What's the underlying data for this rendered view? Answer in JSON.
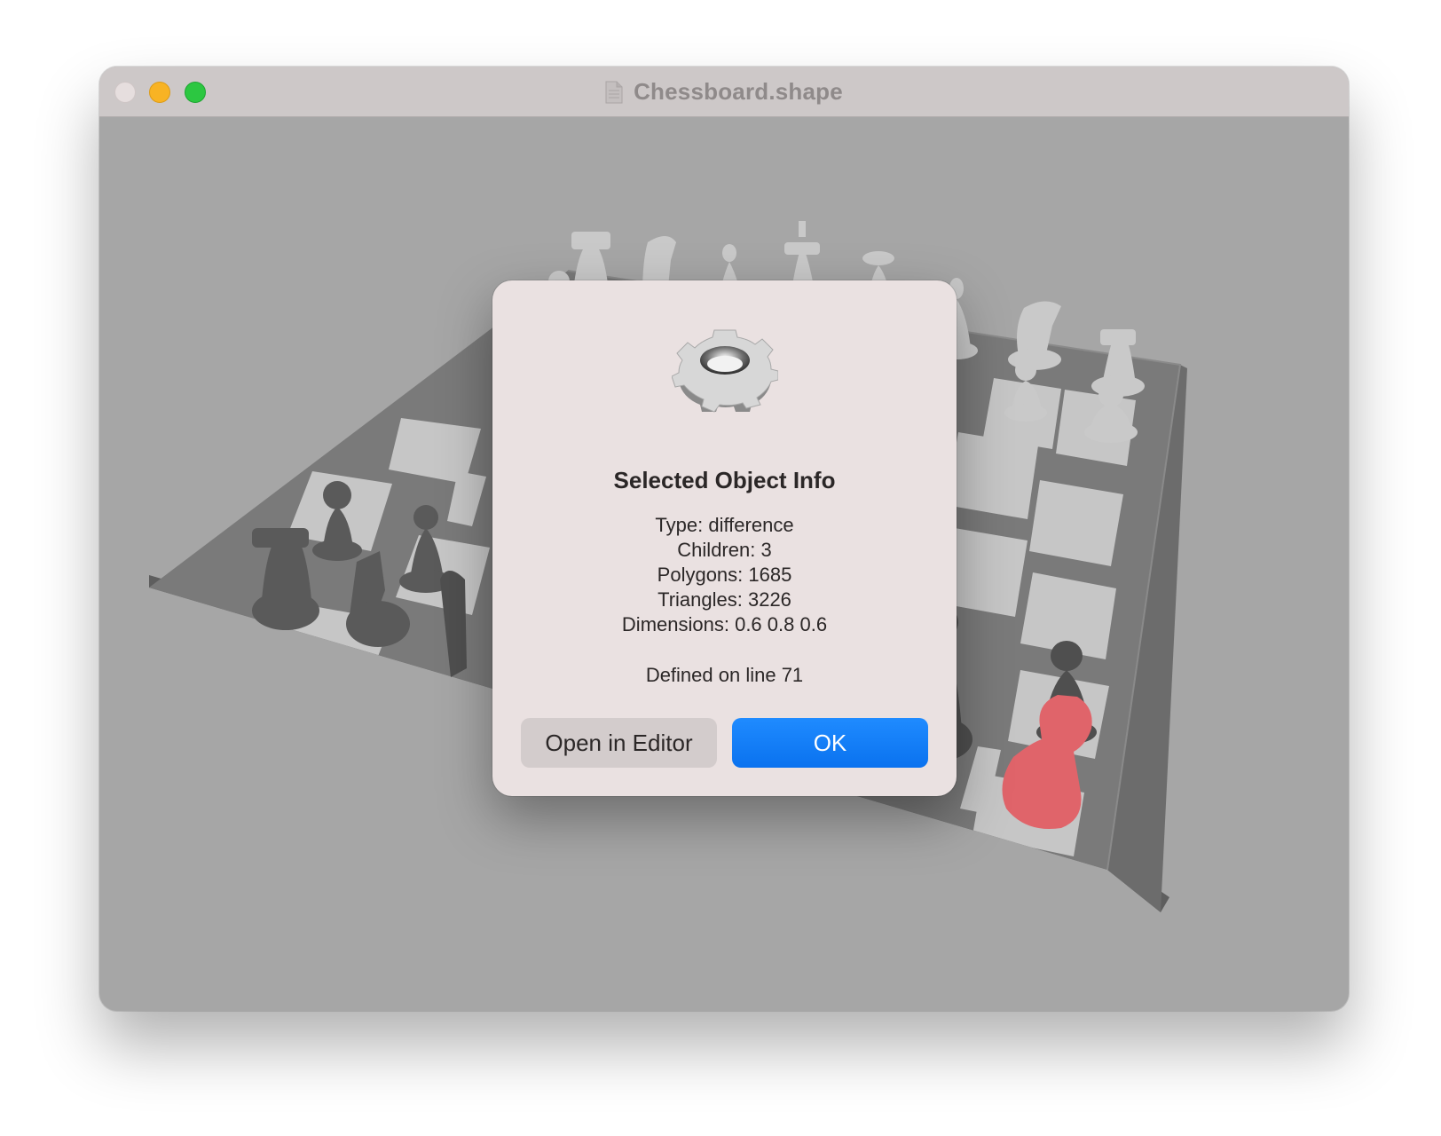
{
  "window": {
    "title": "Chessboard.shape"
  },
  "dialog": {
    "title": "Selected Object Info",
    "info_lines": [
      "Type: difference",
      "Children: 3",
      "Polygons: 1685",
      "Triangles: 3226",
      "Dimensions: 0.6 0.8 0.6"
    ],
    "defined_on": "Defined on line 71",
    "buttons": {
      "open_editor": "Open in Editor",
      "ok": "OK"
    },
    "icon": "gear-icon"
  },
  "colors": {
    "accent": "#0a7aff",
    "selected_piece": "#e0646a",
    "traffic_close": "#e6dede",
    "traffic_minimize": "#f8b324",
    "traffic_maximize": "#2cc741"
  }
}
